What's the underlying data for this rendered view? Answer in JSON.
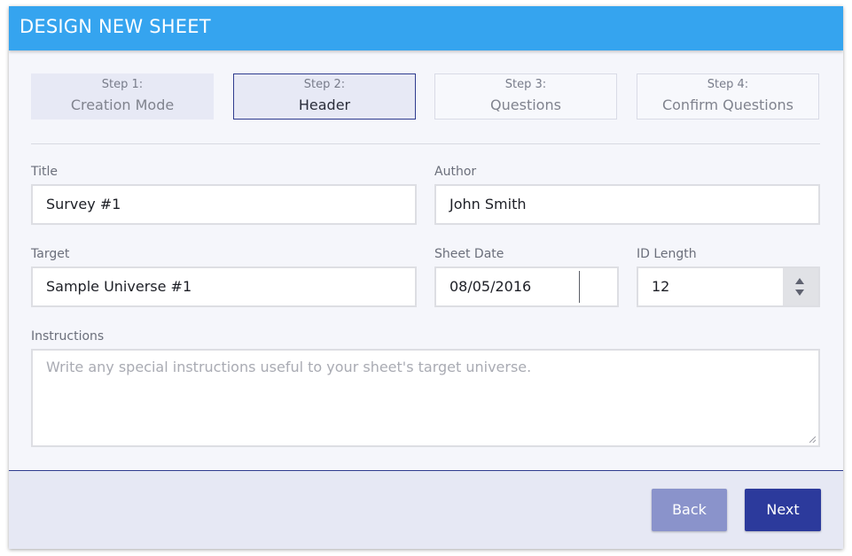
{
  "header": {
    "title": "DESIGN NEW SHEET"
  },
  "steps": [
    {
      "number": "Step 1:",
      "name": "Creation Mode",
      "state": "done"
    },
    {
      "number": "Step 2:",
      "name": "Header",
      "state": "active"
    },
    {
      "number": "Step 3:",
      "name": "Questions",
      "state": "pending"
    },
    {
      "number": "Step 4:",
      "name": "Confirm Questions",
      "state": "pending"
    }
  ],
  "form": {
    "title": {
      "label": "Title",
      "value": "Survey #1"
    },
    "author": {
      "label": "Author",
      "value": "John Smith"
    },
    "target": {
      "label": "Target",
      "value": "Sample Universe #1"
    },
    "sheet_date": {
      "label": "Sheet Date",
      "value": "08/05/2016"
    },
    "id_length": {
      "label": "ID Length",
      "value": "12"
    },
    "instructions": {
      "label": "Instructions",
      "value": "",
      "placeholder": "Write any special instructions useful to your sheet's target universe."
    }
  },
  "footer": {
    "back_label": "Back",
    "next_label": "Next"
  },
  "colors": {
    "header_bg": "#35a4ef",
    "primary": "#2c3a9c",
    "primary_disabled": "#8a93cb",
    "panel_bg": "#f5f6fb",
    "footer_bg": "#e6e8f4"
  }
}
